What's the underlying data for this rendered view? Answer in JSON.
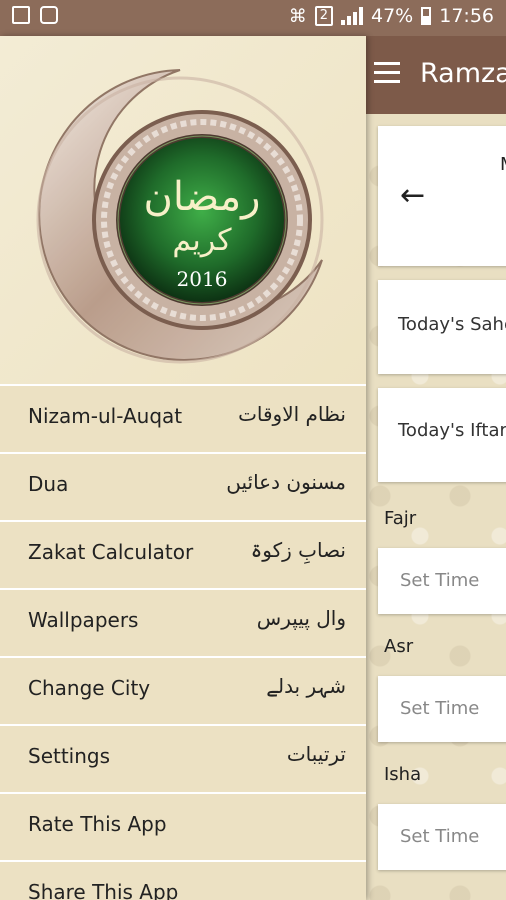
{
  "status_bar": {
    "battery_percent": "47%",
    "time": "17:56",
    "sim_slot": "2",
    "icons": [
      "image-icon",
      "sync-icon",
      "wifi-icon",
      "signal-icon",
      "battery-icon"
    ]
  },
  "app_bar": {
    "title": "Ramza",
    "menu_icon": "hamburger-icon"
  },
  "main": {
    "top_card_letter": "M",
    "sehri_label": "Today's Sahe",
    "iftar_label": "Today's Iftar",
    "prayers": [
      {
        "name": "Fajr",
        "placeholder": "Set Time"
      },
      {
        "name": "Asr",
        "placeholder": "Set Time"
      },
      {
        "name": "Isha",
        "placeholder": "Set Time"
      }
    ]
  },
  "drawer": {
    "emblem_line1": "رمضان",
    "emblem_line2": "کریم",
    "emblem_year": "2016",
    "items": [
      {
        "en": "Nizam-ul-Auqat",
        "ur": "نظام الاوقات"
      },
      {
        "en": "Dua",
        "ur": "مسنون دعائیں"
      },
      {
        "en": "Zakat Calculator",
        "ur": "نصابِ زکوۃ"
      },
      {
        "en": "Wallpapers",
        "ur": "وال پیپرس"
      },
      {
        "en": "Change City",
        "ur": "شہر بدلے"
      },
      {
        "en": "Settings",
        "ur": "ترتیبات"
      },
      {
        "en": "Rate This App",
        "ur": ""
      },
      {
        "en": "Share This App",
        "ur": ""
      }
    ]
  },
  "colors": {
    "status_bar": "#8c6c5a",
    "app_bar": "#7d5a49",
    "drawer_bg": "#ece1c3",
    "emblem_green": "#1f6b2a"
  }
}
